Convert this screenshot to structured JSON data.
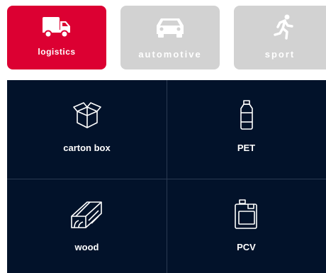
{
  "tabs": [
    {
      "label": "logistics",
      "icon": "truck-icon",
      "active": true
    },
    {
      "label": "automotive",
      "icon": "car-icon",
      "active": false
    },
    {
      "label": "sport",
      "icon": "runner-icon",
      "active": false
    }
  ],
  "materials": [
    {
      "label": "carton box",
      "icon": "carton-box-icon"
    },
    {
      "label": "PET",
      "icon": "bottle-icon"
    },
    {
      "label": "wood",
      "icon": "wood-plank-icon"
    },
    {
      "label": "PCV",
      "icon": "jerrycan-icon"
    }
  ],
  "colors": {
    "active_tab": "#dc0032",
    "inactive_tab": "#d2d2d2",
    "panel_bg": "#02122a"
  }
}
